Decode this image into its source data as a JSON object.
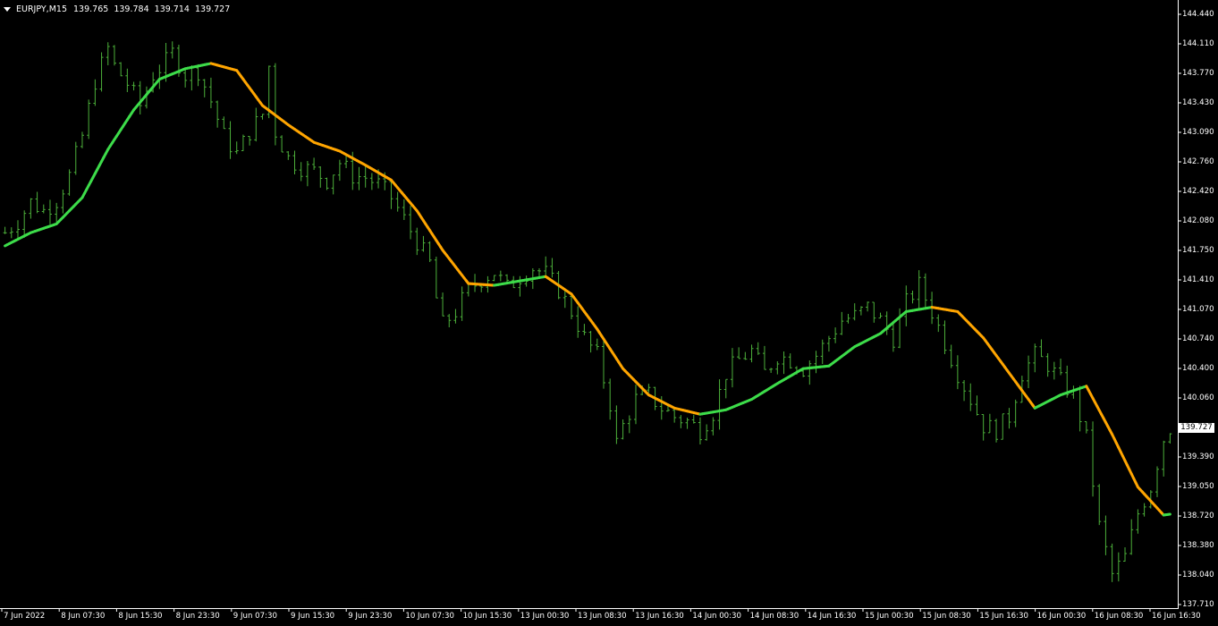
{
  "header": {
    "symbol": "EURJPY,M15",
    "open": "139.765",
    "high": "139.784",
    "low": "139.714",
    "close": "139.727"
  },
  "chart_data": {
    "type": "bar",
    "symbol": "EURJPY",
    "timeframe": "M15",
    "background": "#000000",
    "bar_color": "#4CAF3A",
    "ma_up_color": "#3DDC4A",
    "ma_down_color": "#FFA500",
    "grid": false,
    "y_ticks": [
      "144.440",
      "144.110",
      "143.770",
      "143.430",
      "143.090",
      "142.760",
      "142.420",
      "142.080",
      "141.750",
      "141.410",
      "141.070",
      "140.740",
      "140.400",
      "140.060",
      "139.727",
      "139.390",
      "139.050",
      "138.720",
      "138.380",
      "138.040",
      "137.710"
    ],
    "ylim": [
      137.71,
      144.44
    ],
    "x_ticks": [
      "7 Jun 2022",
      "8 Jun 07:30",
      "8 Jun 15:30",
      "8 Jun 23:30",
      "9 Jun 07:30",
      "9 Jun 15:30",
      "9 Jun 23:30",
      "10 Jun 07:30",
      "10 Jun 15:30",
      "13 Jun 00:30",
      "13 Jun 08:30",
      "13 Jun 16:30",
      "14 Jun 00:30",
      "14 Jun 08:30",
      "14 Jun 16:30",
      "15 Jun 00:30",
      "15 Jun 08:30",
      "15 Jun 16:30",
      "16 Jun 00:30",
      "16 Jun 08:30",
      "16 Jun 16:30"
    ],
    "current_price": "139.727",
    "close_path": [
      [
        0,
        141.95
      ],
      [
        2,
        142.08
      ],
      [
        4,
        142.3
      ],
      [
        6,
        142.2
      ],
      [
        8,
        142.32
      ],
      [
        10,
        142.6
      ],
      [
        12,
        143.05
      ],
      [
        14,
        143.68
      ],
      [
        16,
        144.05
      ],
      [
        17,
        143.85
      ],
      [
        19,
        143.65
      ],
      [
        21,
        143.4
      ],
      [
        23,
        143.75
      ],
      [
        25,
        143.9
      ],
      [
        26,
        144.0
      ],
      [
        28,
        143.75
      ],
      [
        30,
        143.8
      ],
      [
        32,
        143.45
      ],
      [
        34,
        143.05
      ],
      [
        36,
        142.85
      ],
      [
        38,
        143.1
      ],
      [
        40,
        143.3
      ],
      [
        41,
        143.85
      ],
      [
        42,
        143.1
      ],
      [
        44,
        142.8
      ],
      [
        46,
        142.7
      ],
      [
        48,
        142.65
      ],
      [
        50,
        142.55
      ],
      [
        52,
        142.75
      ],
      [
        54,
        142.6
      ],
      [
        56,
        142.58
      ],
      [
        58,
        142.5
      ],
      [
        60,
        142.35
      ],
      [
        62,
        142.1
      ],
      [
        64,
        141.85
      ],
      [
        66,
        141.6
      ],
      [
        67,
        141.2
      ],
      [
        68,
        140.9
      ],
      [
        70,
        141.05
      ],
      [
        72,
        141.3
      ],
      [
        74,
        141.42
      ],
      [
        76,
        141.5
      ],
      [
        78,
        141.32
      ],
      [
        80,
        141.45
      ],
      [
        82,
        141.55
      ],
      [
        84,
        141.48
      ],
      [
        86,
        141.3
      ],
      [
        88,
        141.05
      ],
      [
        90,
        140.75
      ],
      [
        92,
        140.55
      ],
      [
        94,
        140.0
      ],
      [
        95,
        139.55
      ],
      [
        96,
        139.75
      ],
      [
        98,
        140.05
      ],
      [
        100,
        140.1
      ],
      [
        102,
        139.95
      ],
      [
        104,
        139.85
      ],
      [
        106,
        139.8
      ],
      [
        108,
        139.7
      ],
      [
        110,
        139.9
      ],
      [
        112,
        140.35
      ],
      [
        114,
        140.5
      ],
      [
        116,
        140.6
      ],
      [
        118,
        140.35
      ],
      [
        120,
        140.55
      ],
      [
        122,
        140.5
      ],
      [
        124,
        140.4
      ],
      [
        126,
        140.55
      ],
      [
        128,
        140.75
      ],
      [
        130,
        140.95
      ],
      [
        132,
        141.0
      ],
      [
        134,
        141.1
      ],
      [
        136,
        140.95
      ],
      [
        138,
        140.75
      ],
      [
        140,
        141.15
      ],
      [
        142,
        141.35
      ],
      [
        144,
        141.05
      ],
      [
        146,
        140.7
      ],
      [
        148,
        140.35
      ],
      [
        150,
        140.05
      ],
      [
        152,
        139.75
      ],
      [
        154,
        139.7
      ],
      [
        156,
        139.85
      ],
      [
        158,
        140.35
      ],
      [
        160,
        140.55
      ],
      [
        162,
        140.45
      ],
      [
        164,
        140.25
      ],
      [
        166,
        140.1
      ],
      [
        168,
        139.6
      ],
      [
        170,
        138.6
      ],
      [
        172,
        138.05
      ],
      [
        174,
        138.25
      ],
      [
        176,
        138.75
      ],
      [
        178,
        139.05
      ],
      [
        180,
        139.6
      ],
      [
        181,
        139.727
      ]
    ],
    "ma_path": [
      [
        0,
        141.8
      ],
      [
        4,
        141.95
      ],
      [
        8,
        142.05
      ],
      [
        12,
        142.35
      ],
      [
        16,
        142.9
      ],
      [
        20,
        143.35
      ],
      [
        24,
        143.7
      ],
      [
        28,
        143.82
      ],
      [
        32,
        143.88
      ],
      [
        36,
        143.8
      ],
      [
        40,
        143.4
      ],
      [
        44,
        143.18
      ],
      [
        48,
        142.98
      ],
      [
        52,
        142.88
      ],
      [
        56,
        142.72
      ],
      [
        60,
        142.55
      ],
      [
        64,
        142.2
      ],
      [
        68,
        141.75
      ],
      [
        72,
        141.37
      ],
      [
        76,
        141.35
      ],
      [
        80,
        141.4
      ],
      [
        84,
        141.45
      ],
      [
        88,
        141.25
      ],
      [
        92,
        140.85
      ],
      [
        96,
        140.4
      ],
      [
        100,
        140.1
      ],
      [
        104,
        139.95
      ],
      [
        108,
        139.88
      ],
      [
        112,
        139.93
      ],
      [
        116,
        140.05
      ],
      [
        120,
        140.23
      ],
      [
        124,
        140.4
      ],
      [
        128,
        140.43
      ],
      [
        132,
        140.65
      ],
      [
        136,
        140.8
      ],
      [
        140,
        141.05
      ],
      [
        144,
        141.1
      ],
      [
        148,
        141.05
      ],
      [
        152,
        140.75
      ],
      [
        156,
        140.35
      ],
      [
        160,
        139.95
      ],
      [
        164,
        140.1
      ],
      [
        168,
        140.2
      ],
      [
        172,
        139.65
      ],
      [
        176,
        139.05
      ],
      [
        180,
        138.73
      ],
      [
        181,
        138.74
      ]
    ]
  }
}
